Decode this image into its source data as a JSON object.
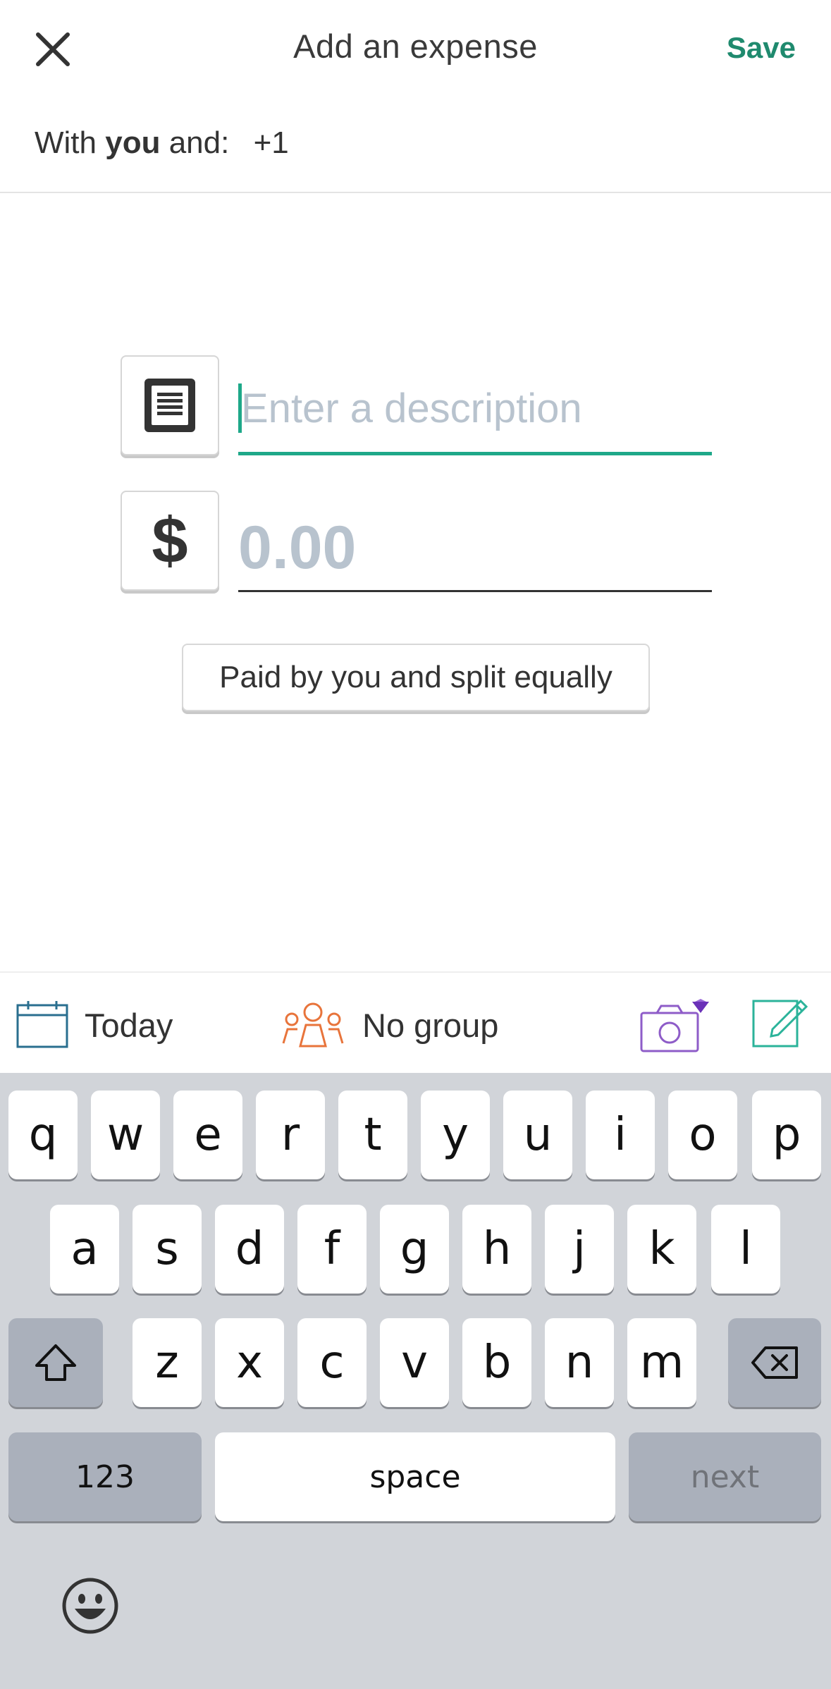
{
  "header": {
    "title": "Add an expense",
    "save_label": "Save"
  },
  "with_row": {
    "prefix": "With",
    "bold": "you",
    "suffix": "and:",
    "count": "+1"
  },
  "description": {
    "placeholder": "Enter a description"
  },
  "amount": {
    "currency_symbol": "$",
    "placeholder": "0.00"
  },
  "split_button_label": "Paid by you and split equally",
  "toolbar": {
    "date_label": "Today",
    "group_label": "No group"
  },
  "colors": {
    "accent_green": "#1f8a6e",
    "field_underline": "#1ea889",
    "calendar_blue": "#2a6f8f",
    "group_orange": "#e8743b",
    "camera_purple": "#8e5cc8",
    "premium_badge": "#6b32b8"
  },
  "icons": [
    "close-icon",
    "notes-list-icon",
    "calendar-icon",
    "group-people-icon",
    "camera-icon",
    "premium-diamond-icon",
    "edit-note-icon",
    "shift-icon",
    "backspace-icon",
    "emoji-icon"
  ],
  "keyboard": {
    "row1": [
      "q",
      "w",
      "e",
      "r",
      "t",
      "y",
      "u",
      "i",
      "o",
      "p"
    ],
    "row2": [
      "a",
      "s",
      "d",
      "f",
      "g",
      "h",
      "j",
      "k",
      "l"
    ],
    "row3": [
      "z",
      "x",
      "c",
      "v",
      "b",
      "n",
      "m"
    ],
    "numbers_label": "123",
    "space_label": "space",
    "next_label": "next"
  }
}
